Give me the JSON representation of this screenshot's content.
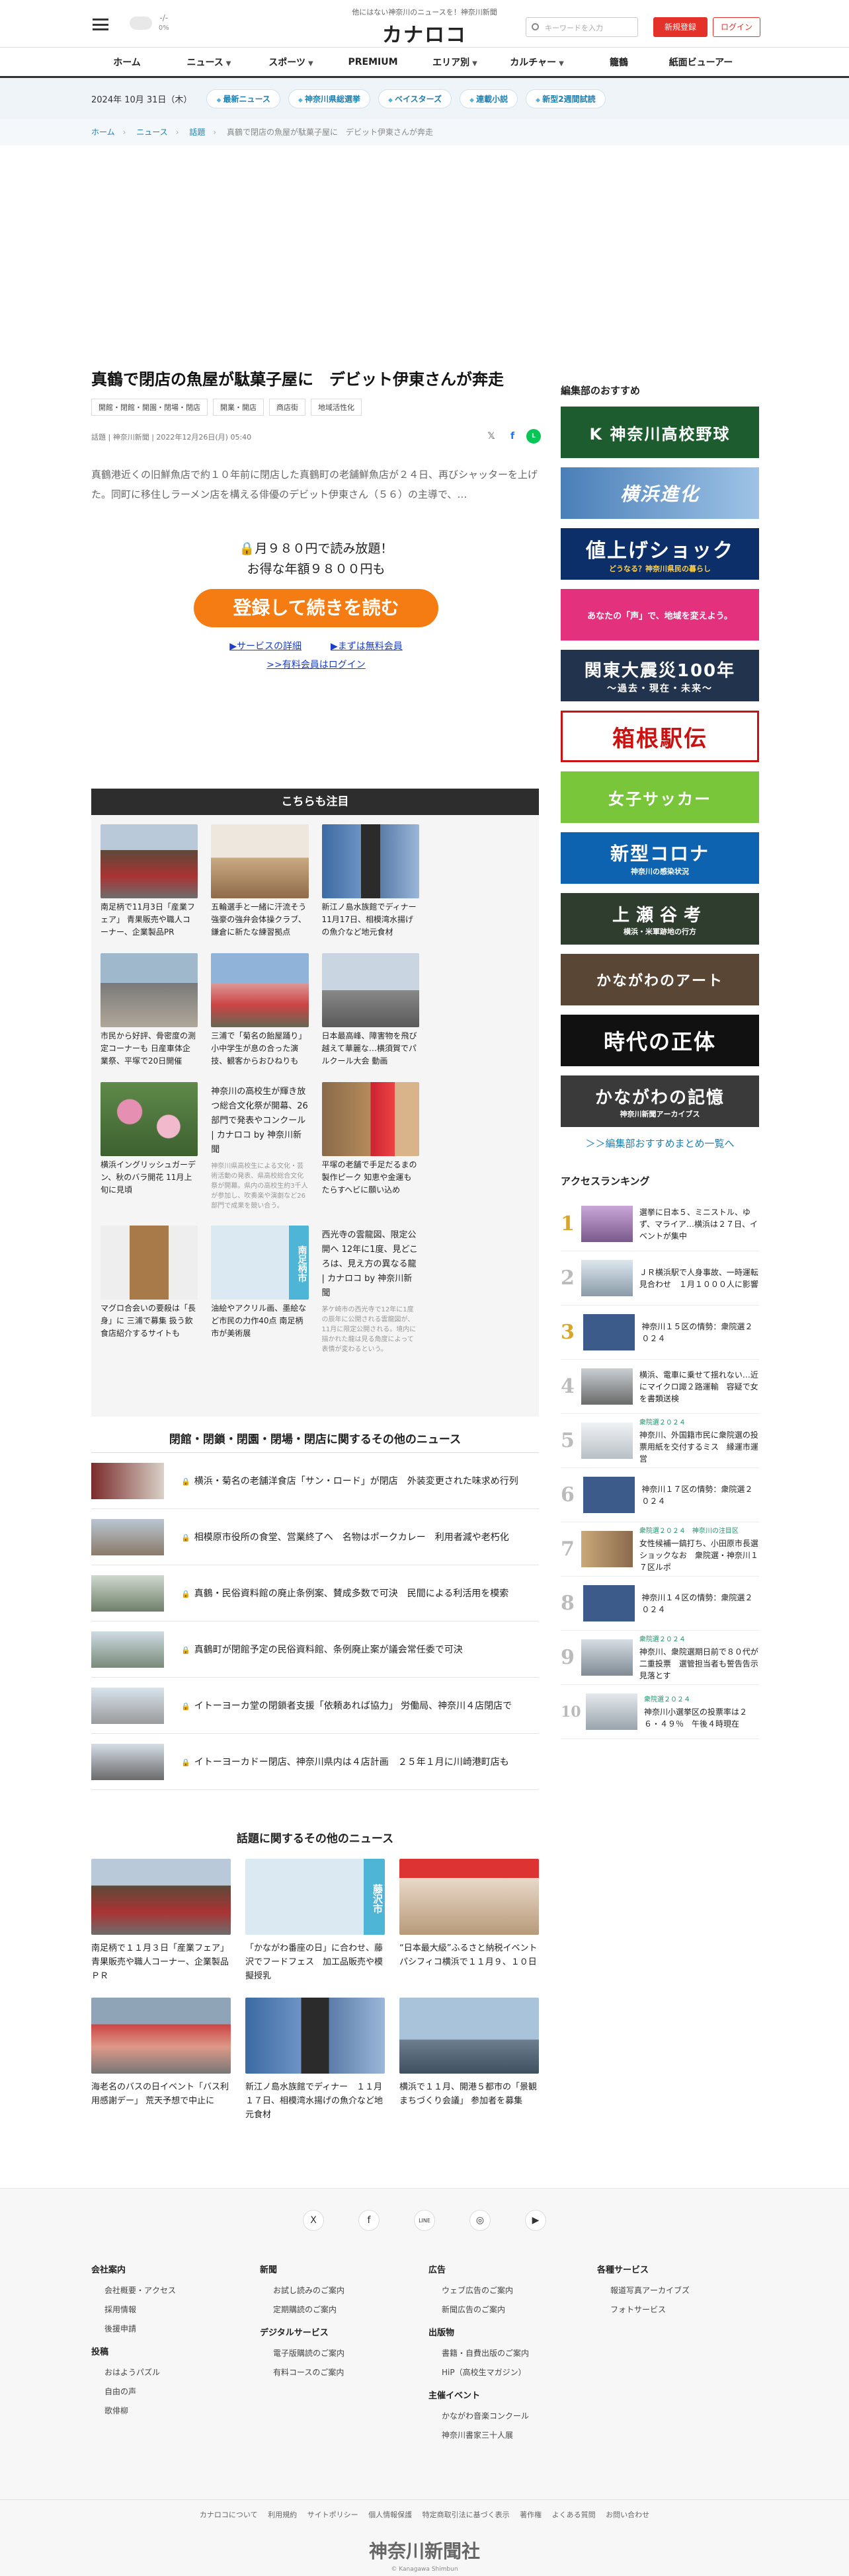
{
  "header": {
    "tagline": "他にはない神奈川のニュースを！神奈川新聞",
    "logo": "カナロコ",
    "weather_temp": "-/-",
    "weather_pct": "0%",
    "search_placeholder": "キーワードを入力",
    "register": "新規登録",
    "login": "ログイン"
  },
  "nav": [
    "ホーム",
    "ニュース",
    "スポーツ",
    "PREMIUM",
    "エリア別",
    "カルチャー",
    "籠鶴",
    "紙面ビューアー"
  ],
  "datebar": {
    "date": "2024年 10月 31日（木）",
    "tags": [
      "最新ニュース",
      "神奈川県総選挙",
      "ベイスターズ",
      "連載小説",
      "新型2週間試読"
    ]
  },
  "breadcrumb": [
    "ホーム",
    "ニュース",
    "話題",
    "真鶴で閉店の魚屋が駄菓子屋に　デビット伊東さんが奔走"
  ],
  "article": {
    "title": "真鶴で閉店の魚屋が駄菓子屋に　デビット伊東さんが奔走",
    "tags": [
      "開館・閉館・開園・閉場・閉店",
      "開業・開店",
      "商店街",
      "地域活性化"
    ],
    "meta": "話題 | 神奈川新聞 | 2022年12月26日(月) 05:40",
    "lead": "真鶴港近くの旧鮮魚店で約１０年前に閉店した真鶴町の老舗鮮魚店が２４日、再びシャッターを上げた。同町に移住しラーメン店を構える俳優のデビット伊東さん（５６）の主導で、…",
    "paywall_line1": "月９８０円で読み放題！",
    "paywall_line2": "お得な年額９８００円も",
    "cta": "登録して続きを読む",
    "link_service": "▶サービスの詳細",
    "link_free": "▶まずは無料会員",
    "link_login": ">>有料会員はログイン"
  },
  "attention": {
    "heading": "こちらも注目",
    "cards": [
      {
        "caption": "南足柄で11月3日「産業フェア」 青果販売や職人コーナー、企業製品PR"
      },
      {
        "caption": "五輪選手と一緒に汗流そう 強豪の強弁会体操クラブ、鎌倉に新たな練習拠点"
      },
      {
        "caption": "新江ノ島水族館でディナー 11月17日、相模湾水揚げの魚介など地元食材"
      },
      {
        "caption": "市民から好評、骨密度の測定コーナーも 日産車体企業祭、平塚で20日開催"
      },
      {
        "caption": "三浦で「菊名の飴屋踊り」 小中学生が息の合った演技、観客からおひねりも"
      },
      {
        "caption": "日本最高峰、障害物を飛び越えて華麗な…横須賀でパルクール大会 動画"
      },
      {
        "caption": "横浜イングリッシュガーデン、秋のバラ開花 11月上旬に見頃"
      },
      {
        "caption": "神奈川の高校生が輝き放つ総合文化祭が開幕、26部門で発表やコンクール | カナロコ by 神奈川新聞",
        "note": "神奈川県高校生による文化・芸術活動の発表、県高校総合文化祭が開幕。県内の高校生約3千人が参加し、吹奏楽や演劇など26部門で成果を競い合う。"
      },
      {
        "caption": "平塚の老舗で手足だるまの製作ピーク 知恵や金運もたらすヘビに願い込め"
      },
      {
        "caption": "マグロ合会いの要殺は「長身」に 三浦で募集 扱う飲食店紹介するサイトも"
      },
      {
        "caption": "油絵やアクリル画、墨絵など市民の力作40点 南足柄市が美術展",
        "city": "南足柄市"
      },
      {
        "caption": "西光寺の雲龍図、限定公開へ 12年に1度、見どころは、見え方の異なる龍 | カナロコ by 神奈川新聞",
        "note": "茅ケ崎市の西光寺で12年に1度の辰年に公開される雲龍図が、11月に限定公開される。境内に描かれた龍は見る角度によって表情が変わるという。"
      }
    ]
  },
  "related1": {
    "heading": "閉館・閉鎖・閉園・閉場・閉店に関するその他のニュース",
    "items": [
      "横浜・菊名の老舗洋食店「サン・ロード」が閉店　外装変更された味求め行列",
      "相模原市役所の食堂、営業終了へ　名物はポークカレー　利用者減や老朽化",
      "真鶴・民俗資料館の廃止条例案、賛成多数で可決　民間による利活用を模索",
      "真鶴町が閉館予定の民俗資料館、条例廃止案が議会常任委で可決",
      "イトーヨーカ堂の閉鎖者支援「依頼あれば協力」 労働局、神奈川４店閉店で",
      "イトーヨーカドー閉店、神奈川県内は４店計画　２５年１月に川崎港町店も"
    ]
  },
  "related2": {
    "heading": "話題に関するその他のニュース",
    "cards": [
      {
        "caption": "南足柄で１１月３日「産業フェア」 青果販売や職人コーナー、企業製品ＰＲ"
      },
      {
        "caption": "「かながわ番座の日」に合わせ、藤沢でフードフェス　加工品販売や模擬授乳",
        "city": "藤沢市"
      },
      {
        "caption": "“日本最大級”ふるさと納税イベント　パシフィコ横浜で１１月９、１０日"
      },
      {
        "caption": "海老名のバスの日イベント「バス利用感謝デー」 荒天予想で中止に"
      },
      {
        "caption": "新江ノ島水族館でディナー　１１月１７日、相模湾水揚げの魚介など地元食材"
      },
      {
        "caption": "横浜で１１月、開港５都市の「景観まちづくり会議」 参加者を募集"
      }
    ]
  },
  "sidebar": {
    "heading": "編集部のおすすめ",
    "banners": [
      "K 神奈川高校野球",
      "横浜進化",
      "値上げショック",
      "あなたの「声」で、地域を変えよう。",
      "関東大震災100年",
      "箱根駅伝",
      "女子サッカー",
      "新型コロナ",
      "上瀬谷考",
      "かながわのアート",
      "時代の正体",
      "かながわの記憶"
    ],
    "banner_subs": [
      "",
      "",
      "どうなる？神奈川県民の暮らし",
      "",
      "〜過去・現在・未来〜",
      "",
      "",
      "神奈川の感染状況",
      "横浜・米軍跡地の行方",
      "",
      "",
      "神奈川新聞アーカイブス"
    ],
    "more": "＞＞編集部おすすめまとめ一覧へ",
    "ranking_heading": "アクセスランキング",
    "ranking": [
      {
        "num": "1",
        "badge": "",
        "text": "選挙に日本５、ミニストル、ゆず、マライア…横浜は２７日、イベントが集中"
      },
      {
        "num": "2",
        "badge": "",
        "text": "ＪＲ横浜駅で人身事故、一時運転見合わせ　１月１０００人に影響"
      },
      {
        "num": "3",
        "badge": "",
        "text": "神奈川１５区の情勢：衆院選２０２４"
      },
      {
        "num": "4",
        "badge": "",
        "text": "横浜、電車に乗せて揺れない…近にマイクロ諏２路運輸　容疑で女を書類送検"
      },
      {
        "num": "5",
        "badge": "衆院選２０２４",
        "text": "神奈川、外国籍市民に衆院選の投票用紙を交付するミス　縁運市運営"
      },
      {
        "num": "6",
        "badge": "",
        "text": "神奈川１７区の情勢：衆院選２０２４"
      },
      {
        "num": "7",
        "badge": "衆院選２０２４　神奈川の注目区",
        "text": "女性候補一鎬打ち、小田原市長選ショックなお　衆院選・神奈川１７区ルポ"
      },
      {
        "num": "8",
        "badge": "",
        "text": "神奈川１４区の情勢：衆院選２０２４"
      },
      {
        "num": "9",
        "badge": "衆院選２０２４",
        "text": "神奈川、衆院選期日前で８０代が二重投票　選管担当者も誓告告示見落とす"
      },
      {
        "num": "10",
        "badge": "衆院選２０２４",
        "text": "神奈川小選挙区の投票率は２６・４９％　午後４時現在"
      }
    ]
  },
  "footer": {
    "sns": [
      "X",
      "f",
      "LINE",
      "◎",
      "▶"
    ],
    "cols": [
      {
        "groups": [
          {
            "title": "会社案内",
            "items": [
              "会社概要・アクセス",
              "採用情報",
              "後援申請"
            ]
          },
          {
            "title": "投稿",
            "items": [
              "おはようパズル",
              "自由の声",
              "歌俳柳"
            ]
          }
        ]
      },
      {
        "groups": [
          {
            "title": "新聞",
            "items": [
              "お試し読みのご案内",
              "定期購読のご案内"
            ]
          },
          {
            "title": "デジタルサービス",
            "items": [
              "電子版購読のご案内",
              "有料コースのご案内"
            ]
          }
        ]
      },
      {
        "groups": [
          {
            "title": "広告",
            "items": [
              "ウェブ広告のご案内",
              "新聞広告のご案内"
            ]
          },
          {
            "title": "出版物",
            "items": [
              "書籍・自費出版のご案内",
              "HiP（高校生マガジン）"
            ]
          },
          {
            "title": "主催イベント",
            "items": [
              "かながわ音楽コンクール",
              "神奈川書家三十人展"
            ]
          }
        ]
      },
      {
        "groups": [
          {
            "title": "各種サービス",
            "items": [
              "報道写真アーカイブズ",
              "フォトサービス"
            ]
          }
        ]
      }
    ],
    "bottom_links": [
      "カナロコについて",
      "利用規約",
      "サイトポリシー",
      "個人情報保護",
      "特定商取引法に基づく表示",
      "著作権",
      "よくある質問",
      "お問い合わせ"
    ],
    "logo": "神奈川新聞社",
    "copyright": "© Kanagawa Shimbun"
  }
}
